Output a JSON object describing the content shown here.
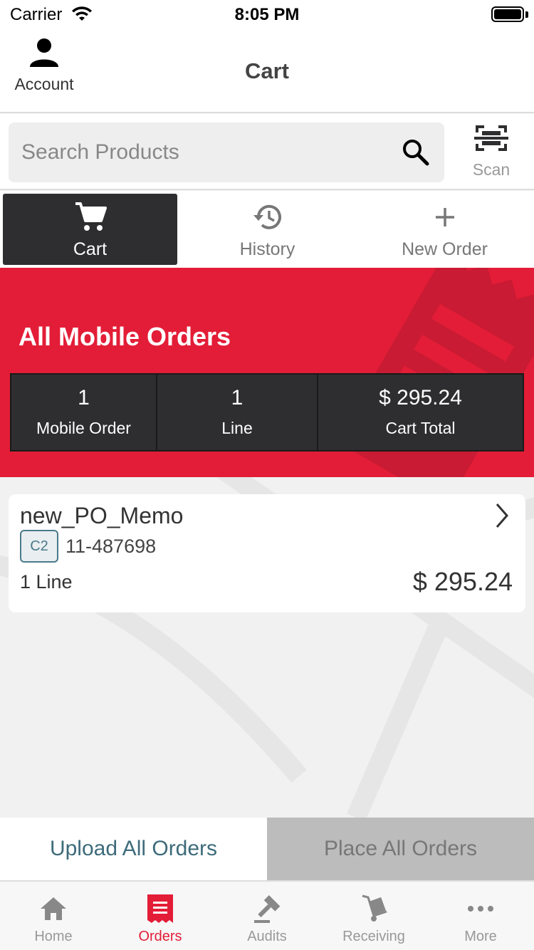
{
  "status_bar": {
    "carrier": "Carrier",
    "time": "8:05 PM"
  },
  "header": {
    "account_label": "Account",
    "title": "Cart"
  },
  "search": {
    "placeholder": "Search Products",
    "scan_label": "Scan"
  },
  "tabs": [
    {
      "label": "Cart",
      "icon": "cart-icon",
      "active": true
    },
    {
      "label": "History",
      "icon": "history-icon",
      "active": false
    },
    {
      "label": "New Order",
      "icon": "plus-icon",
      "active": false
    }
  ],
  "banner": {
    "title": "All Mobile Orders",
    "stats": [
      {
        "value": "1",
        "label": "Mobile Order"
      },
      {
        "value": "1",
        "label": "Line"
      },
      {
        "value": "$ 295.24",
        "label": "Cart Total"
      }
    ]
  },
  "orders": [
    {
      "name": "new_PO_Memo",
      "badge": "C2",
      "account": "11-487698",
      "lines": "1 Line",
      "total": "$ 295.24"
    }
  ],
  "actions": {
    "upload_label": "Upload All Orders",
    "place_label": "Place All Orders"
  },
  "bottom_nav": [
    {
      "label": "Home",
      "icon": "home-icon",
      "active": false
    },
    {
      "label": "Orders",
      "icon": "orders-icon",
      "active": true
    },
    {
      "label": "Audits",
      "icon": "gavel-icon",
      "active": false
    },
    {
      "label": "Receiving",
      "icon": "hand-truck-icon",
      "active": false
    },
    {
      "label": "More",
      "icon": "more-dots-icon",
      "active": false
    }
  ],
  "colors": {
    "brand_red": "#e31d37",
    "dark": "#2e2e30",
    "teal": "#3d6b7a"
  }
}
